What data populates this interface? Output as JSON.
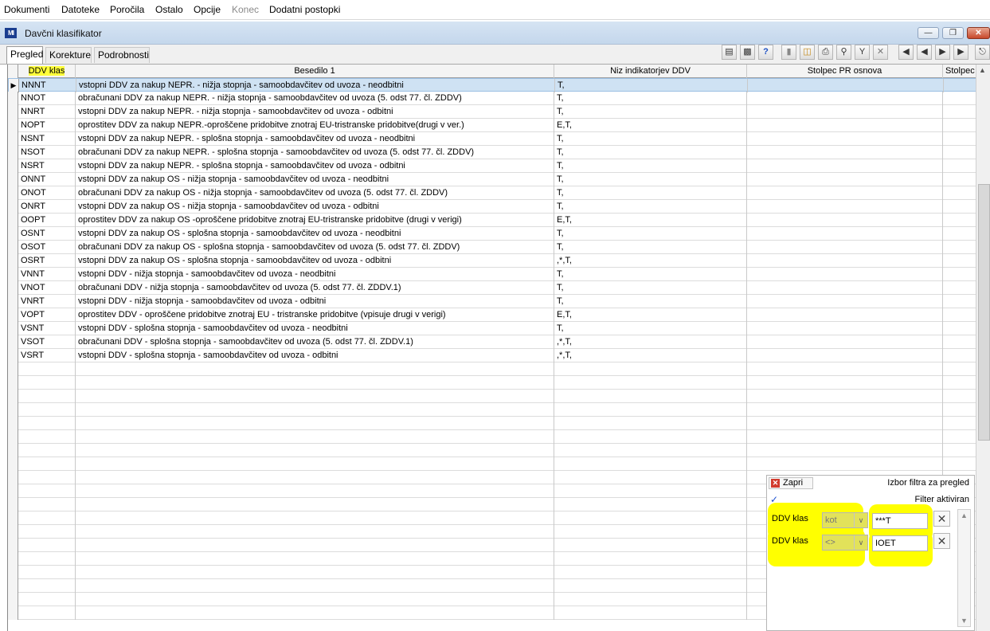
{
  "menu": [
    "Dokumenti",
    "Datoteke",
    "Poročila",
    "Ostalo",
    "Opcije",
    "Konec",
    "Dodatni postopki"
  ],
  "window": {
    "title": "Davčni klasifikator",
    "icon": "app-logo-icon"
  },
  "tabs": [
    "Pregled",
    "Korekture",
    "Podrobnosti"
  ],
  "toolbar_icons": [
    "report-icon",
    "export-icon",
    "help-icon",
    "new-record-icon",
    "open-folder-icon",
    "print-icon",
    "find-icon",
    "filter-icon",
    "clear-filter-icon",
    "first-record-icon",
    "previous-record-icon",
    "next-record-icon",
    "last-record-icon",
    "exit-icon"
  ],
  "grid": {
    "headers": [
      "DDV klas",
      "Besedilo 1",
      "Niz indikatorjev DDV",
      "Stolpec PR osnova",
      "Stolpec P"
    ],
    "rows": [
      {
        "code": "NNNT",
        "text": "vstopni DDV za nakup NEPR. - nižja stopnja - samoobdavčitev od uvoza - neodbitni",
        "ind": "T,"
      },
      {
        "code": "NNOT",
        "text": "obračunani DDV za nakup NEPR. - nižja stopnja - samoobdavčitev od uvoza (5. odst 77. čl. ZDDV)",
        "ind": "T,"
      },
      {
        "code": "NNRT",
        "text": "vstopni DDV za nakup NEPR. - nižja stopnja - samoobdavčitev od uvoza - odbitni",
        "ind": "T,"
      },
      {
        "code": "NOPT",
        "text": "oprostitev DDV za nakup NEPR.-oproščene pridobitve znotraj EU-tristranske pridobitve(drugi v ver.)",
        "ind": "E,T,"
      },
      {
        "code": "NSNT",
        "text": "vstopni DDV za nakup NEPR. - splošna stopnja - samoobdavčitev od uvoza - neodbitni",
        "ind": "T,"
      },
      {
        "code": "NSOT",
        "text": "obračunani DDV za nakup NEPR. - splošna stopnja - samoobdavčitev od uvoza (5. odst 77. čl. ZDDV)",
        "ind": "T,"
      },
      {
        "code": "NSRT",
        "text": "vstopni DDV za nakup NEPR. - splošna stopnja - samoobdavčitev od uvoza - odbitni",
        "ind": "T,"
      },
      {
        "code": "ONNT",
        "text": "vstopni DDV za nakup OS - nižja stopnja - samoobdavčitev od uvoza - neodbitni",
        "ind": "T,"
      },
      {
        "code": "ONOT",
        "text": "obračunani DDV za nakup OS - nižja stopnja - samoobdavčitev od uvoza (5. odst 77. čl. ZDDV)",
        "ind": "T,"
      },
      {
        "code": "ONRT",
        "text": "vstopni DDV za nakup OS - nižja stopnja - samoobdavčitev od uvoza - odbitni",
        "ind": "T,"
      },
      {
        "code": "OOPT",
        "text": "oprostitev DDV za nakup OS -oproščene pridobitve znotraj EU-tristranske pridobitve (drugi v verigi)",
        "ind": "E,T,"
      },
      {
        "code": "OSNT",
        "text": "vstopni DDV za nakup OS - splošna stopnja - samoobdavčitev od uvoza - neodbitni",
        "ind": "T,"
      },
      {
        "code": "OSOT",
        "text": "obračunani DDV za nakup OS - splošna stopnja - samoobdavčitev od uvoza (5. odst 77. čl. ZDDV)",
        "ind": "T,"
      },
      {
        "code": "OSRT",
        "text": "vstopni DDV za nakup OS - splošna stopnja - samoobdavčitev od uvoza - odbitni",
        "ind": ",*,T,"
      },
      {
        "code": "VNNT",
        "text": "vstopni DDV - nižja stopnja - samoobdavčitev od uvoza - neodbitni",
        "ind": "T,"
      },
      {
        "code": "VNOT",
        "text": "obračunani DDV - nižja stopnja - samoobdavčitev od uvoza (5. odst 77. čl. ZDDV.1)",
        "ind": "T,"
      },
      {
        "code": "VNRT",
        "text": "vstopni DDV - nižja stopnja - samoobdavčitev od uvoza - odbitni",
        "ind": "T,"
      },
      {
        "code": "VOPT",
        "text": "oprostitev DDV - oproščene pridobitve znotraj EU - tristranske pridobitve (vpisuje drugi v verigi)",
        "ind": "E,T,"
      },
      {
        "code": "VSNT",
        "text": "vstopni DDV - splošna stopnja - samoobdavčitev od uvoza - neodbitni",
        "ind": "T,"
      },
      {
        "code": "VSOT",
        "text": "obračunani DDV - splošna stopnja - samoobdavčitev od uvoza (5. odst 77. čl. ZDDV.1)",
        "ind": ",*,T,"
      },
      {
        "code": "VSRT",
        "text": "vstopni DDV - splošna stopnja - samoobdavčitev od uvoza - odbitni",
        "ind": ",*,T,"
      }
    ],
    "empty_rows": 19
  },
  "filter": {
    "close_label": "Zapri",
    "title": "Izbor filtra za pregled",
    "status": "Filter aktiviran",
    "rows": [
      {
        "field": "DDV klas",
        "operator": "kot",
        "value": "***T"
      },
      {
        "field": "DDV klas",
        "operator": "<>",
        "value": "IOET"
      }
    ]
  },
  "colors": {
    "highlight": "#ffff00",
    "selected_row": "#cfe2f3",
    "title_bar": "#c4d7ec"
  }
}
